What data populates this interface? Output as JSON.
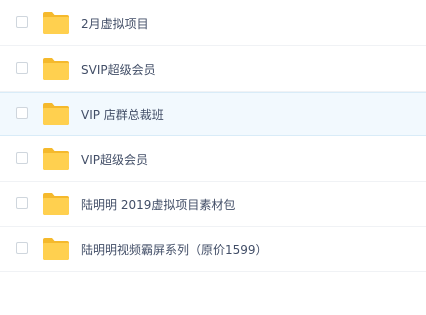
{
  "files": [
    {
      "name": "2月虚拟项目",
      "icon": "folder-icon"
    },
    {
      "name": "SVIP超级会员",
      "icon": "folder-icon"
    },
    {
      "name": "VIP 店群总裁班",
      "icon": "folder-icon",
      "highlighted": true
    },
    {
      "name": "VIP超级会员",
      "icon": "folder-icon"
    },
    {
      "name": "陆明明 2019虚拟项目素材包",
      "icon": "folder-icon"
    },
    {
      "name": "陆明明视频霸屏系列（原价1599）",
      "icon": "folder-icon"
    }
  ],
  "colors": {
    "folder": "#ffd04f",
    "folder_tab": "#f5b92c",
    "row_highlight": "#f2f9fe",
    "text": "#424e67"
  }
}
